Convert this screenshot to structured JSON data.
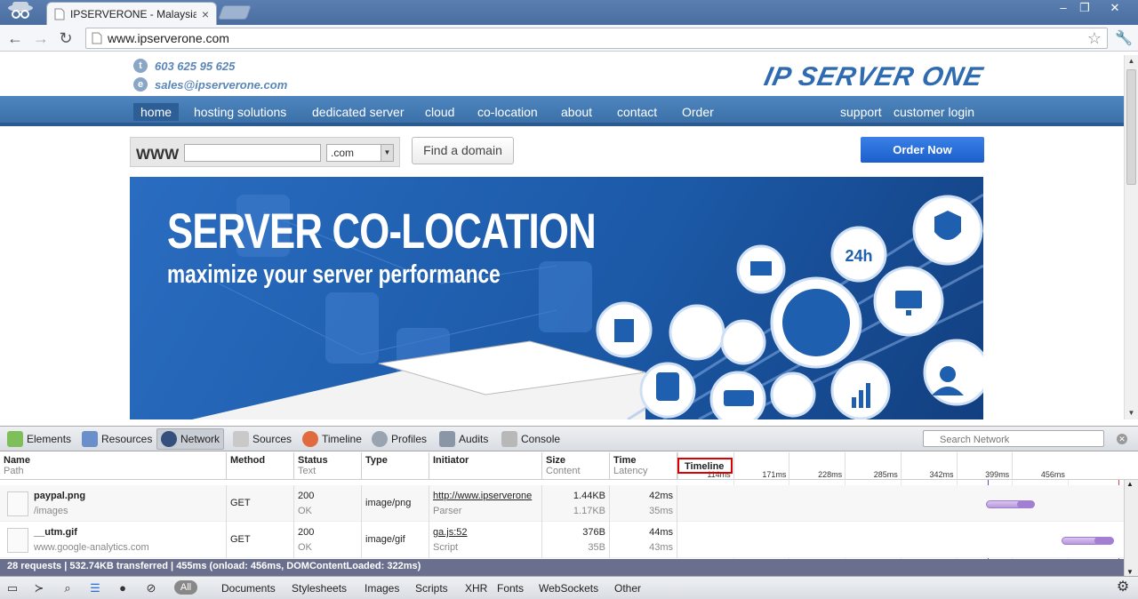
{
  "browser": {
    "tab_title": "IPSERVERONE - Malaysia Wel",
    "url": "www.ipserverone.com",
    "window_controls": [
      "–",
      "❐",
      "✕"
    ]
  },
  "site": {
    "phone_icon": "t",
    "phone": "603 625 95 625",
    "email_icon": "e",
    "email": "sales@ipserverone.com",
    "logo": "IP SERVER ONE",
    "nav": [
      "home",
      "hosting solutions",
      "dedicated server",
      "cloud",
      "co-location",
      "about",
      "contact",
      "Order"
    ],
    "nav_right": [
      "support",
      "customer login"
    ],
    "domain_prefix": "WWW",
    "domain_tld": ".com",
    "find_domain": "Find a domain",
    "order_now": "Order Now",
    "banner_title": "SERVER CO-LOCATION",
    "banner_subtitle": "maximize your server performance"
  },
  "devtools": {
    "tabs": [
      "Elements",
      "Resources",
      "Network",
      "Sources",
      "Timeline",
      "Profiles",
      "Audits",
      "Console"
    ],
    "search_placeholder": "Search Network",
    "columns": {
      "name": "Name",
      "name_sub": "Path",
      "method": "Method",
      "status": "Status",
      "status_sub": "Text",
      "type": "Type",
      "initiator": "Initiator",
      "size": "Size",
      "size_sub": "Content",
      "time": "Time",
      "time_sub": "Latency",
      "timeline": "Timeline"
    },
    "ticks": [
      "114ms",
      "171ms",
      "228ms",
      "285ms",
      "342ms",
      "399ms",
      "456ms"
    ],
    "rows": [
      {
        "name": "paypal.png",
        "path": "/images",
        "method": "GET",
        "status": "200",
        "status_text": "OK",
        "type": "image/png",
        "initiator": "http://www.ipserverone",
        "initiator_sub": "Parser",
        "size": "1.44KB",
        "content": "1.17KB",
        "time": "42ms",
        "latency": "35ms",
        "bar_start": 0.7,
        "bar_end": 0.81
      },
      {
        "name": "__utm.gif",
        "path": "www.google-analytics.com",
        "method": "GET",
        "status": "200",
        "status_text": "OK",
        "type": "image/gif",
        "initiator": "ga.js:52",
        "initiator_sub": "Script",
        "size": "376B",
        "content": "35B",
        "time": "44ms",
        "latency": "43ms",
        "bar_start": 0.87,
        "bar_end": 0.99
      }
    ],
    "status_line": "28 requests   |   532.74KB transferred   |   455ms (onload: 456ms, DOMContentLoaded: 322ms)",
    "filters": [
      "All",
      "Documents",
      "Stylesheets",
      "Images",
      "Scripts",
      "XHR",
      "Fonts",
      "WebSockets",
      "Other"
    ]
  }
}
